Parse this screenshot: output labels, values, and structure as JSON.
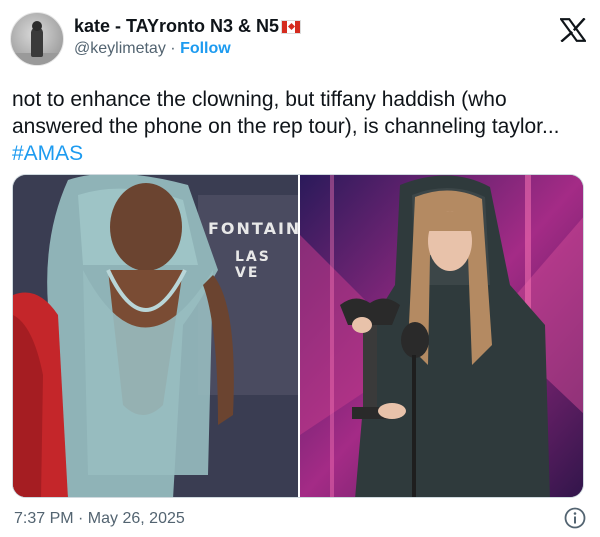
{
  "tweet": {
    "author": {
      "display_name": "kate - TAYronto N3 & N5",
      "handle": "@keylimetay",
      "separator": "·",
      "follow_label": "Follow",
      "avatar_icon": "avatar",
      "flag_icon": "canada-flag-icon"
    },
    "platform_icon": "x-logo-icon",
    "text": "not to enhance the clowning, but tiffany haddish (who answered the phone on the rep tour), is channeling taylor...",
    "hashtag": "#AMAS",
    "media": {
      "left_photo": {
        "sign_line1": "FONTAIN",
        "sign_line2": "LAS VE"
      },
      "right_photo": {}
    },
    "timestamp": "7:37 PM · May 26, 2025",
    "info_icon": "info-icon"
  },
  "colors": {
    "accent": "#1d9bf0",
    "text_primary": "#0f1419",
    "text_secondary": "#536471",
    "border": "#cfd9de"
  }
}
